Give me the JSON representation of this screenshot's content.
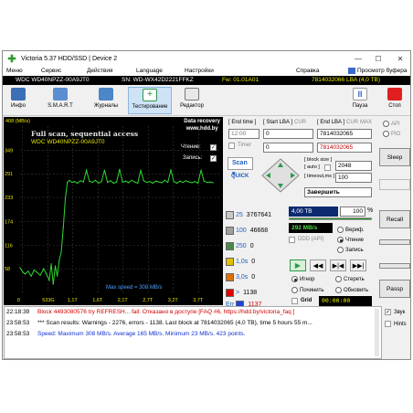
{
  "window": {
    "title": "Victoria 5.37 HDD/SSD | Device 2",
    "min": "—",
    "max": "☐",
    "close": "✕"
  },
  "menu": [
    "Меню",
    "Сервис",
    "Действия",
    "Language",
    "Настройки",
    "Справка",
    "Просмотр буфера"
  ],
  "info": {
    "model": "WDC WD40NPZZ-00A9JT0",
    "serial": "SN: WD-WX42D2221FFKZ",
    "firmware": "Fw: 01.01A01",
    "lba": "7814032066 LBA (4,0 TB)"
  },
  "toolbar": {
    "left": [
      "Инфо",
      "S.M.A.R.T",
      "Журналы",
      "Тестирование",
      "Редактор"
    ],
    "right": [
      "Пауза",
      "Стоп"
    ]
  },
  "graph": {
    "title": "Full scan, sequential access",
    "model": "WDC WD40NPZZ-00A9JT0",
    "brand1": "Data recovery",
    "brand2": "www.hdd.by",
    "read_label": "Чтение:",
    "write_label": "Запись:",
    "max_speed": "Max speed = 308 MB/s",
    "unit": "408 (MB/s)",
    "y_ticks": [
      "349",
      "291",
      "233",
      "174",
      "116",
      "58"
    ],
    "x_ticks": [
      "0",
      "533G",
      "1,1T",
      "1,6T",
      "2,1T",
      "2,7T",
      "3,2T",
      "3,7T"
    ]
  },
  "chart_data": {
    "type": "line",
    "title": "Full scan, sequential access",
    "ylabel": "MB/s",
    "ylim": [
      0,
      408
    ],
    "x_ticks": [
      "0",
      "533G",
      "1,1T",
      "1,6T",
      "2,1T",
      "2,7T",
      "3,2T",
      "3,7T"
    ],
    "series": [
      {
        "name": "Чтение",
        "color": "#2fd92f",
        "x": [
          0.0,
          0.05,
          0.1,
          0.16,
          0.22,
          0.28,
          0.35,
          0.4,
          0.47,
          0.52,
          0.58,
          0.62,
          0.66,
          0.7,
          0.74,
          0.78,
          0.82,
          0.86,
          0.9,
          0.94,
          0.98,
          1.03,
          1.08,
          1.14,
          1.2,
          1.26,
          1.32,
          1.38,
          1.44,
          1.5,
          1.56,
          1.62,
          1.68,
          1.74,
          1.8,
          1.86,
          1.92,
          1.98,
          2.04,
          2.1,
          2.16,
          2.22,
          2.28,
          2.34,
          2.4,
          2.46,
          2.52,
          2.58,
          2.64,
          2.7,
          2.76,
          2.82,
          2.88,
          2.94,
          3.0,
          3.06,
          3.12,
          3.18,
          3.24,
          3.3,
          3.36,
          3.42,
          3.48,
          3.54,
          3.6,
          3.66,
          3.72,
          3.78,
          3.84
        ],
        "y": [
          60,
          50,
          45,
          52,
          40,
          55,
          48,
          42,
          58,
          46,
          30,
          70,
          20,
          65,
          40,
          80,
          100,
          160,
          230,
          270,
          275,
          270,
          272,
          268,
          274,
          271,
          300,
          273,
          270,
          275,
          268,
          272,
          300,
          270,
          274,
          268,
          271,
          302,
          270,
          273,
          269,
          275,
          271,
          268,
          299,
          274,
          270,
          272,
          268,
          273,
          271,
          269,
          275,
          270,
          301,
          272,
          268,
          273,
          270,
          274,
          271,
          269,
          272,
          268,
          300,
          273,
          270,
          271,
          269
        ]
      }
    ],
    "grid": true,
    "legend": "top-right"
  },
  "controls": {
    "end_time_label": "[ End time ]",
    "end_time": "12:00",
    "timer_label": "Timer",
    "timer": "0",
    "start_lba_label": "[ Start LBA ]",
    "start_lba": "0",
    "cur_label": "CUR",
    "end_lba_label": "[ End LBA ]",
    "max_label": "MAX",
    "end_lba": "7814032065",
    "end_lba2": "7814032065",
    "scan_label": "Scan",
    "quick_label": "QUICK",
    "block_size_label": "[ block size ]",
    "auto_label": "[ auto ]",
    "block_size": "2048",
    "timeout_label": "[ timeout,ms ]",
    "timeout": "100",
    "finish_action": "Завершить",
    "size": "4,00 TB",
    "percent": "100",
    "percent_unit": "%",
    "speed": "292 MB/s",
    "ddd_label": "DDD (API)",
    "verify_label": "Вериф.",
    "read_label": "Чтение",
    "write_label": "Запись",
    "ignore_label": "Игнор",
    "erase_label": "Стереть",
    "repair_label": "Починить",
    "update_label": "Обновить",
    "grid_label": "Grid",
    "grid_time": "00:00:00",
    "sectors": [
      {
        "label": "25",
        "count": "3767641",
        "color": "#c8c8c8"
      },
      {
        "label": "100",
        "count": "46668",
        "color": "#a0a0a0"
      },
      {
        "label": "250",
        "count": "0",
        "color": "#4a8a4a"
      },
      {
        "label": "1,0s",
        "count": "0",
        "color": "#e0c000"
      },
      {
        "label": "3,0s",
        "count": "0",
        "color": "#e07000"
      },
      {
        "label": ">",
        "count": "1138",
        "color": "#e00000"
      },
      {
        "label": "Err",
        "count": "1137",
        "color": "#2040e0"
      }
    ]
  },
  "side": {
    "api": "API",
    "pio": "PIO",
    "sleep": "Sleep",
    "recall": "Recall",
    "passp": "Passp"
  },
  "log": [
    {
      "time": "22:18:39",
      "text": "Block 4493080576 try REFRESH... fail: Отказано в доступе [FAQ #6, https://hdd.by/victoria_faq ]",
      "color": "#d00000"
    },
    {
      "time": "23:58:53",
      "text": "*** Scan results: Warnings - 2276, errors - 1138. Last block at 7814032065 (4,0 TB), time 5 hours 55 m...",
      "color": "#000000"
    },
    {
      "time": "23:58:53",
      "text": "Speed: Maximum 308 MB/s. Average 165 MB/s. Minimum 23 MB/s. 423 points.",
      "color": "#1030d0"
    }
  ],
  "log_options": {
    "sound": "Звук",
    "hints": "Hints"
  }
}
